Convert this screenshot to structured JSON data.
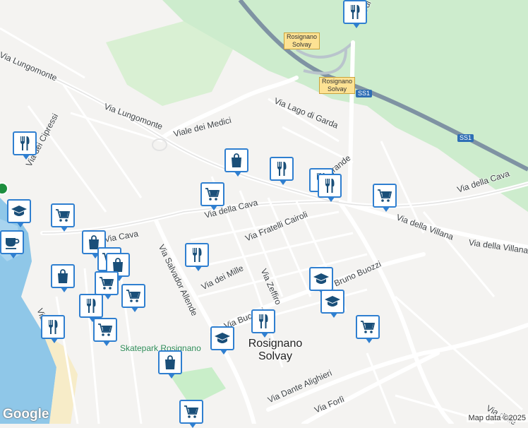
{
  "map": {
    "street_labels": [
      {
        "id": "via-lungomonte-1",
        "text": "Via Lungomonte"
      },
      {
        "id": "via-lungomonte-2",
        "text": "Via Lungomonte"
      },
      {
        "id": "via-dei-cipressi",
        "text": "Via dei Cipressi"
      },
      {
        "id": "viale-dei-medici",
        "text": "Viale dei Medici"
      },
      {
        "id": "via-lago-di-garda",
        "text": "Via Lago di Garda"
      },
      {
        "id": "via-della-cava-1",
        "text": "Via della Cava"
      },
      {
        "id": "via-della-cava-2",
        "text": "Via della Cava"
      },
      {
        "id": "via-cava",
        "text": "Via Cava"
      },
      {
        "id": "via-fratelli-cairoli",
        "text": "Via Fratelli Cairoli"
      },
      {
        "id": "via-salvador-allende",
        "text": "Via Salvador Allende"
      },
      {
        "id": "via-dei-mille",
        "text": "Via dei Mille"
      },
      {
        "id": "via-zeffiro",
        "text": "Via Zeffiro"
      },
      {
        "id": "via-della-villana-1",
        "text": "Via della Villana"
      },
      {
        "id": "via-della-villana-2",
        "text": "Via della Villana"
      },
      {
        "id": "bruno-buozzi",
        "text": "Bruno Buozzi"
      },
      {
        "id": "via-buccari",
        "text": "Via Buccari"
      },
      {
        "id": "via-dante-alighieri",
        "text": "Via Dante Alighieri"
      },
      {
        "id": "via-forli",
        "text": "Via Forlì"
      },
      {
        "id": "via-delle",
        "text": "Via delle"
      },
      {
        "id": "terragrande",
        "text": "Terragrande"
      },
      {
        "id": "via-di",
        "text": "Via di"
      },
      {
        "id": "via-t",
        "text": "Via T"
      }
    ],
    "city_label": {
      "line1": "Rosignano",
      "line2": "Solvay"
    },
    "shields": [
      {
        "id": "rosignano-solvay-shield-1",
        "line1": "Rosignano",
        "line2": "Solvay"
      },
      {
        "id": "rosignano-solvay-shield-2",
        "line1": "Rosignano",
        "line2": "Solvay"
      }
    ],
    "route_badges": [
      {
        "id": "ss1-badge-1",
        "text": "SS1"
      },
      {
        "id": "ss1-badge-2",
        "text": "SS1"
      }
    ],
    "park_label": "Skatepark Rosignano",
    "google_logo": "Google",
    "attribution": "Map data ©2025",
    "colors": {
      "background": "#f4f3f1",
      "forest": "#cdeccd",
      "water": "#8fc7e8",
      "highway": "#7f93a3",
      "poi_border": "#2f7fd0",
      "poi_icon": "#1a4f79"
    },
    "pois": [
      {
        "icon": "restaurant"
      },
      {
        "icon": "shopping-bag"
      },
      {
        "icon": "restaurant"
      },
      {
        "icon": "restaurant"
      },
      {
        "icon": "restaurant"
      },
      {
        "icon": "shopping-cart"
      },
      {
        "icon": "shopping-cart"
      },
      {
        "icon": "education"
      },
      {
        "icon": "shopping-cart"
      },
      {
        "icon": "cafe"
      },
      {
        "icon": "shopping-bag"
      },
      {
        "icon": "shopping-cart"
      },
      {
        "icon": "restaurant"
      },
      {
        "icon": "shopping-bag"
      },
      {
        "icon": "shopping-bag"
      },
      {
        "icon": "shopping-cart"
      },
      {
        "icon": "restaurant"
      },
      {
        "icon": "shopping-cart"
      },
      {
        "icon": "education"
      },
      {
        "icon": "restaurant"
      },
      {
        "icon": "education"
      },
      {
        "icon": "education"
      },
      {
        "icon": "shopping-cart"
      },
      {
        "icon": "restaurant"
      },
      {
        "icon": "shopping-bag"
      },
      {
        "icon": "shopping-cart"
      },
      {
        "icon": "restaurant"
      },
      {
        "icon": "shopping-cart"
      }
    ]
  }
}
